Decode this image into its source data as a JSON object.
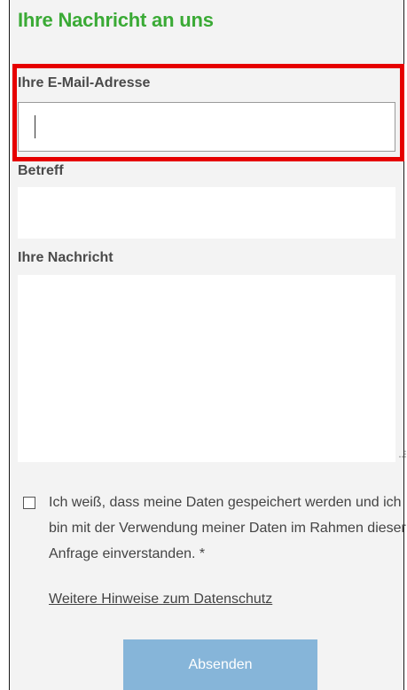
{
  "form": {
    "title": "Ihre Nachricht an uns",
    "email": {
      "label": "Ihre E-Mail-Adresse",
      "value": ""
    },
    "subject": {
      "label": "Betreff",
      "value": ""
    },
    "message": {
      "label": "Ihre Nachricht",
      "value": ""
    },
    "consent": {
      "text": "Ich weiß, dass meine Daten gespeichert werden und ich bin mit der Verwendung meiner Daten im Rahmen dieser Anfrage einverstanden. *",
      "checked": false
    },
    "privacy_link": "Weitere Hinweise zum Datenschutz",
    "submit_label": "Absenden"
  },
  "colors": {
    "title": "#3aaa35",
    "highlight": "#e60000",
    "submit_bg": "#86b5d9",
    "panel_bg": "#f3f3f3"
  },
  "icons": {
    "resize_handle": "resize-grip-icon",
    "checkbox": "checkbox-unchecked-icon"
  }
}
